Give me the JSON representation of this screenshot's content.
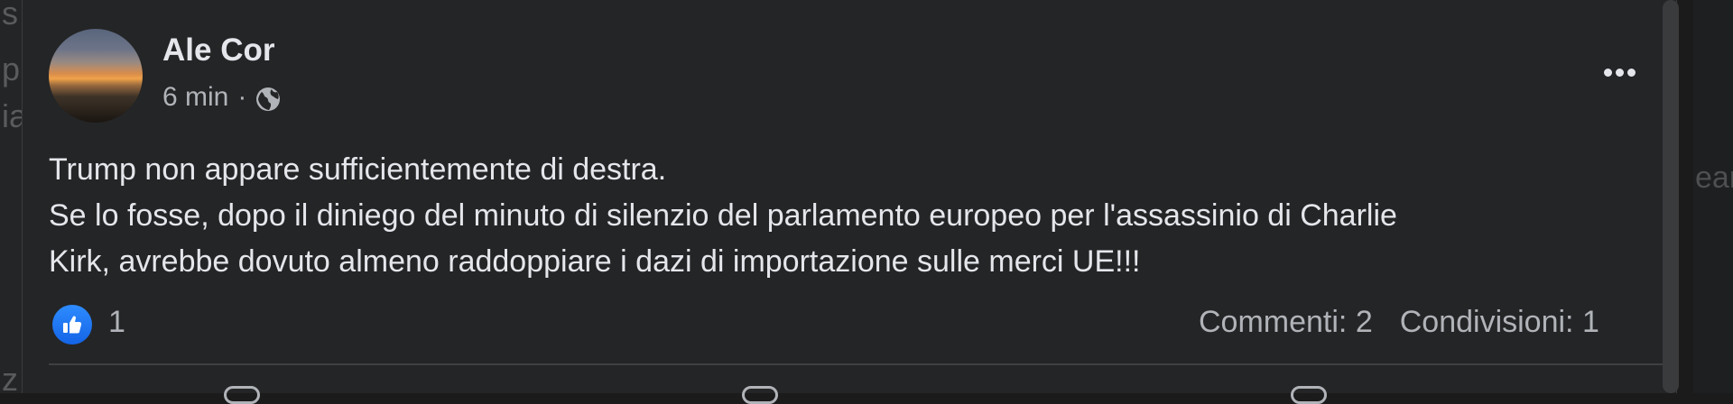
{
  "background": {
    "left_fragments": [
      "s",
      "p",
      "ia"
    ],
    "right_fragment": "ear",
    "bottom_left_fragment": "z"
  },
  "post": {
    "author": "Ale Cor",
    "time": "6 min",
    "separator": "·",
    "audience_icon": "globe-icon",
    "menu_icon": "more-options-icon",
    "text_lines": [
      "Trump non appare sufficientemente di destra.",
      "Se lo fosse, dopo il diniego del minuto di silenzio del parlamento europeo per l'assassinio di Charlie",
      "Kirk, avrebbe dovuto almeno raddoppiare i dazi di importazione sulle merci UE!!!"
    ],
    "reactions": {
      "icon": "like-icon",
      "count": "1"
    },
    "comments": "Commenti: 2",
    "shares": "Condivisioni: 1"
  },
  "colors": {
    "card_bg": "#242526",
    "text_primary": "#e4e6eb",
    "text_secondary": "#b0b3b8",
    "like_blue": "#1877f2"
  }
}
